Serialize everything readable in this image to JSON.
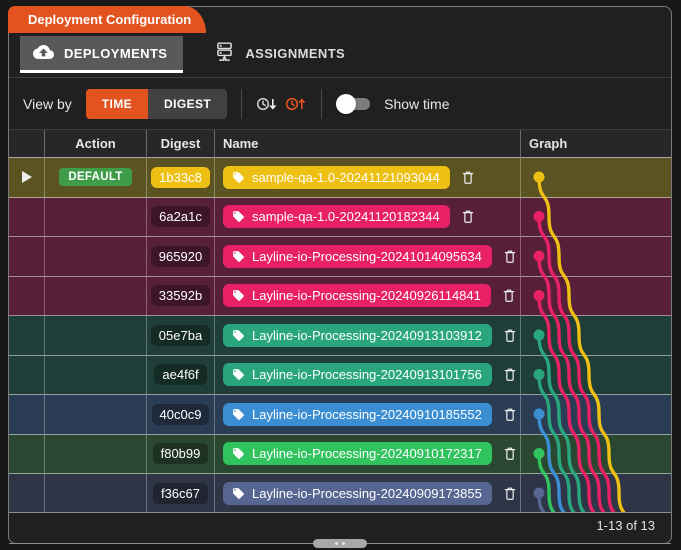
{
  "title_tab": {
    "label": "Deployment Configuration"
  },
  "tabs": [
    {
      "label": "DEPLOYMENTS",
      "icon": "cloud-upload-icon",
      "active": true
    },
    {
      "label": "ASSIGNMENTS",
      "icon": "server-rack-icon",
      "active": false
    }
  ],
  "view_by": {
    "label": "View by",
    "options": [
      {
        "label": "TIME",
        "active": true
      },
      {
        "label": "DIGEST",
        "active": false
      }
    ]
  },
  "sort_icons": [
    "clock-sort-desc-icon",
    "clock-sort-asc-icon"
  ],
  "show_time": {
    "label": "Show time",
    "on": false
  },
  "table": {
    "columns": [
      "",
      "Action",
      "Digest",
      "Name",
      "Graph"
    ],
    "rows": [
      {
        "action": "DEFAULT",
        "is_default": true,
        "digest": "1b33c8",
        "digest_highlight": true,
        "name": "sample-qa-1.0-20241121093044",
        "color": "#edc013",
        "row_bg": "#5c5322"
      },
      {
        "digest": "6a2a1c",
        "name": "sample-qa-1.0-20241120182344",
        "color": "#e72163",
        "row_bg": "#572038"
      },
      {
        "digest": "965920",
        "name": "Layline-io-Processing-20241014095634",
        "color": "#e72163",
        "row_bg": "#572038"
      },
      {
        "digest": "33592b",
        "name": "Layline-io-Processing-20240926114841",
        "color": "#e72163",
        "row_bg": "#572038"
      },
      {
        "digest": "05e7ba",
        "name": "Layline-io-Processing-20240913103912",
        "color": "#2aa67f",
        "row_bg": "#1f3e37"
      },
      {
        "digest": "ae4f6f",
        "name": "Layline-io-Processing-20240913101756",
        "color": "#2aa67f",
        "row_bg": "#1f3e37"
      },
      {
        "digest": "40c0c9",
        "name": "Layline-io-Processing-20240910185552",
        "color": "#3c8ed2",
        "row_bg": "#2b3d54"
      },
      {
        "digest": "f80b99",
        "name": "Layline-io-Processing-20240910172317",
        "color": "#30c35e",
        "row_bg": "#2a4831"
      },
      {
        "digest": "f36c67",
        "name": "Layline-io-Processing-20240909173855",
        "color": "#566691",
        "row_bg": "#2e3547"
      }
    ]
  },
  "footer": {
    "range_label": "1-13 of 13"
  },
  "colors": {
    "accent_orange": "#e2531f",
    "active_tab_bg": "#595959",
    "default_badge_green": "#3f9d49",
    "panel_bg": "#202020"
  }
}
